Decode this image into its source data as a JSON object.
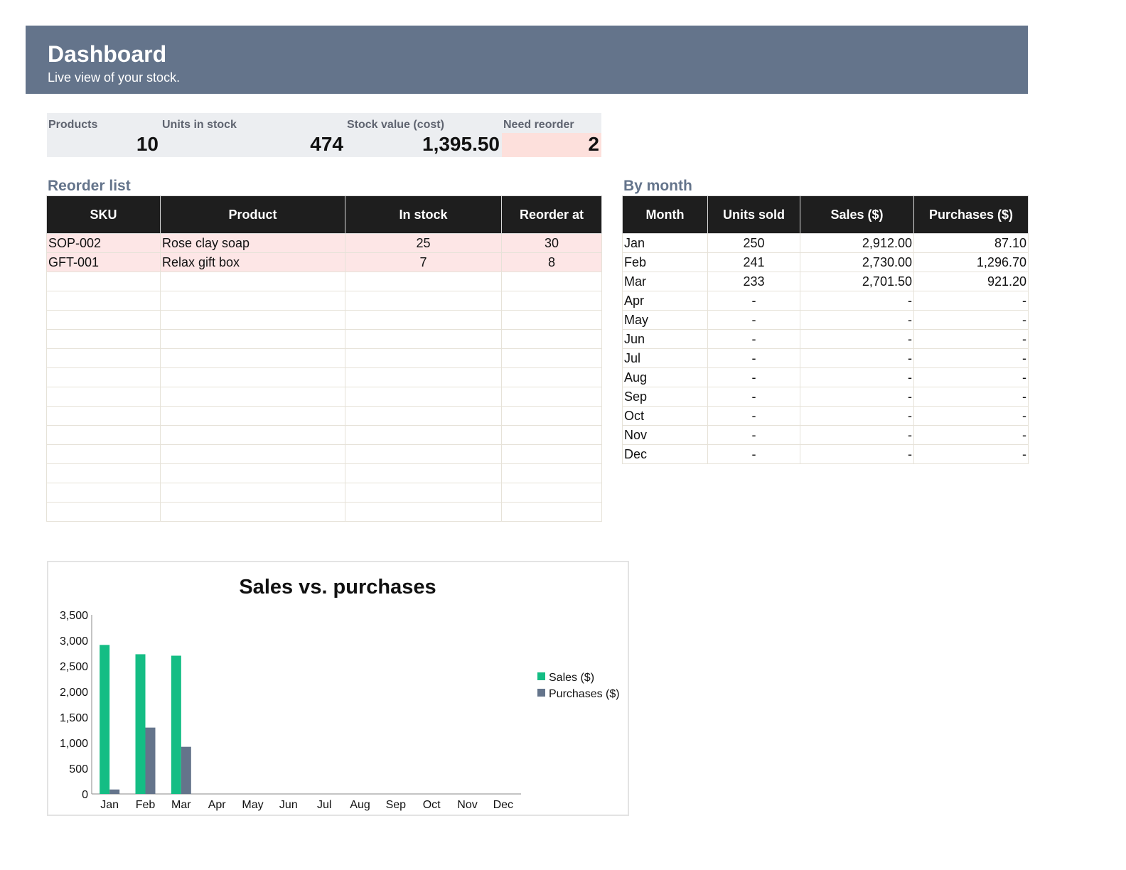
{
  "header": {
    "title": "Dashboard",
    "subtitle": "Live view of your stock."
  },
  "kpis": [
    {
      "label": "Products",
      "value": "10"
    },
    {
      "label": "Units in stock",
      "value": "474"
    },
    {
      "label": "Stock value (cost)",
      "value": "1,395.50"
    },
    {
      "label": "Need reorder",
      "value": "2"
    }
  ],
  "reorder": {
    "title": "Reorder list",
    "columns": [
      "SKU",
      "Product",
      "In stock",
      "Reorder at"
    ],
    "rows": [
      [
        "SOP-002",
        "Rose clay soap",
        "25",
        "30"
      ],
      [
        "GFT-001",
        "Relax gift box",
        "7",
        "8"
      ]
    ]
  },
  "by_month": {
    "title": "By month",
    "columns": [
      "Month",
      "Units sold",
      "Sales ($)",
      "Purchases ($)"
    ],
    "rows": [
      [
        "Jan",
        "250",
        "2,912.00",
        "87.10"
      ],
      [
        "Feb",
        "241",
        "2,730.00",
        "1,296.70"
      ],
      [
        "Mar",
        "233",
        "2,701.50",
        "921.20"
      ],
      [
        "Apr",
        "-",
        "-",
        "-"
      ],
      [
        "May",
        "-",
        "-",
        "-"
      ],
      [
        "Jun",
        "-",
        "-",
        "-"
      ],
      [
        "Jul",
        "-",
        "-",
        "-"
      ],
      [
        "Aug",
        "-",
        "-",
        "-"
      ],
      [
        "Sep",
        "-",
        "-",
        "-"
      ],
      [
        "Oct",
        "-",
        "-",
        "-"
      ],
      [
        "Nov",
        "-",
        "-",
        "-"
      ],
      [
        "Dec",
        "-",
        "-",
        "-"
      ]
    ]
  },
  "colors": {
    "banner": "#64748b",
    "sales": "#14bd84",
    "purchases": "#64748b",
    "reorder_highlight": "#fde6e6"
  },
  "chart_data": {
    "type": "bar",
    "title": "Sales vs. purchases",
    "categories": [
      "Jan",
      "Feb",
      "Mar",
      "Apr",
      "May",
      "Jun",
      "Jul",
      "Aug",
      "Sep",
      "Oct",
      "Nov",
      "Dec"
    ],
    "series": [
      {
        "name": "Sales ($)",
        "values": [
          2912.0,
          2730.0,
          2701.5,
          0,
          0,
          0,
          0,
          0,
          0,
          0,
          0,
          0
        ]
      },
      {
        "name": "Purchases ($)",
        "values": [
          87.1,
          1296.7,
          921.2,
          0,
          0,
          0,
          0,
          0,
          0,
          0,
          0,
          0
        ]
      }
    ],
    "ylim": [
      0,
      3500
    ],
    "yticks": [
      "0",
      "500",
      "1,000",
      "1,500",
      "2,000",
      "2,500",
      "3,000",
      "3,500"
    ],
    "grid": false,
    "legend": "right"
  }
}
